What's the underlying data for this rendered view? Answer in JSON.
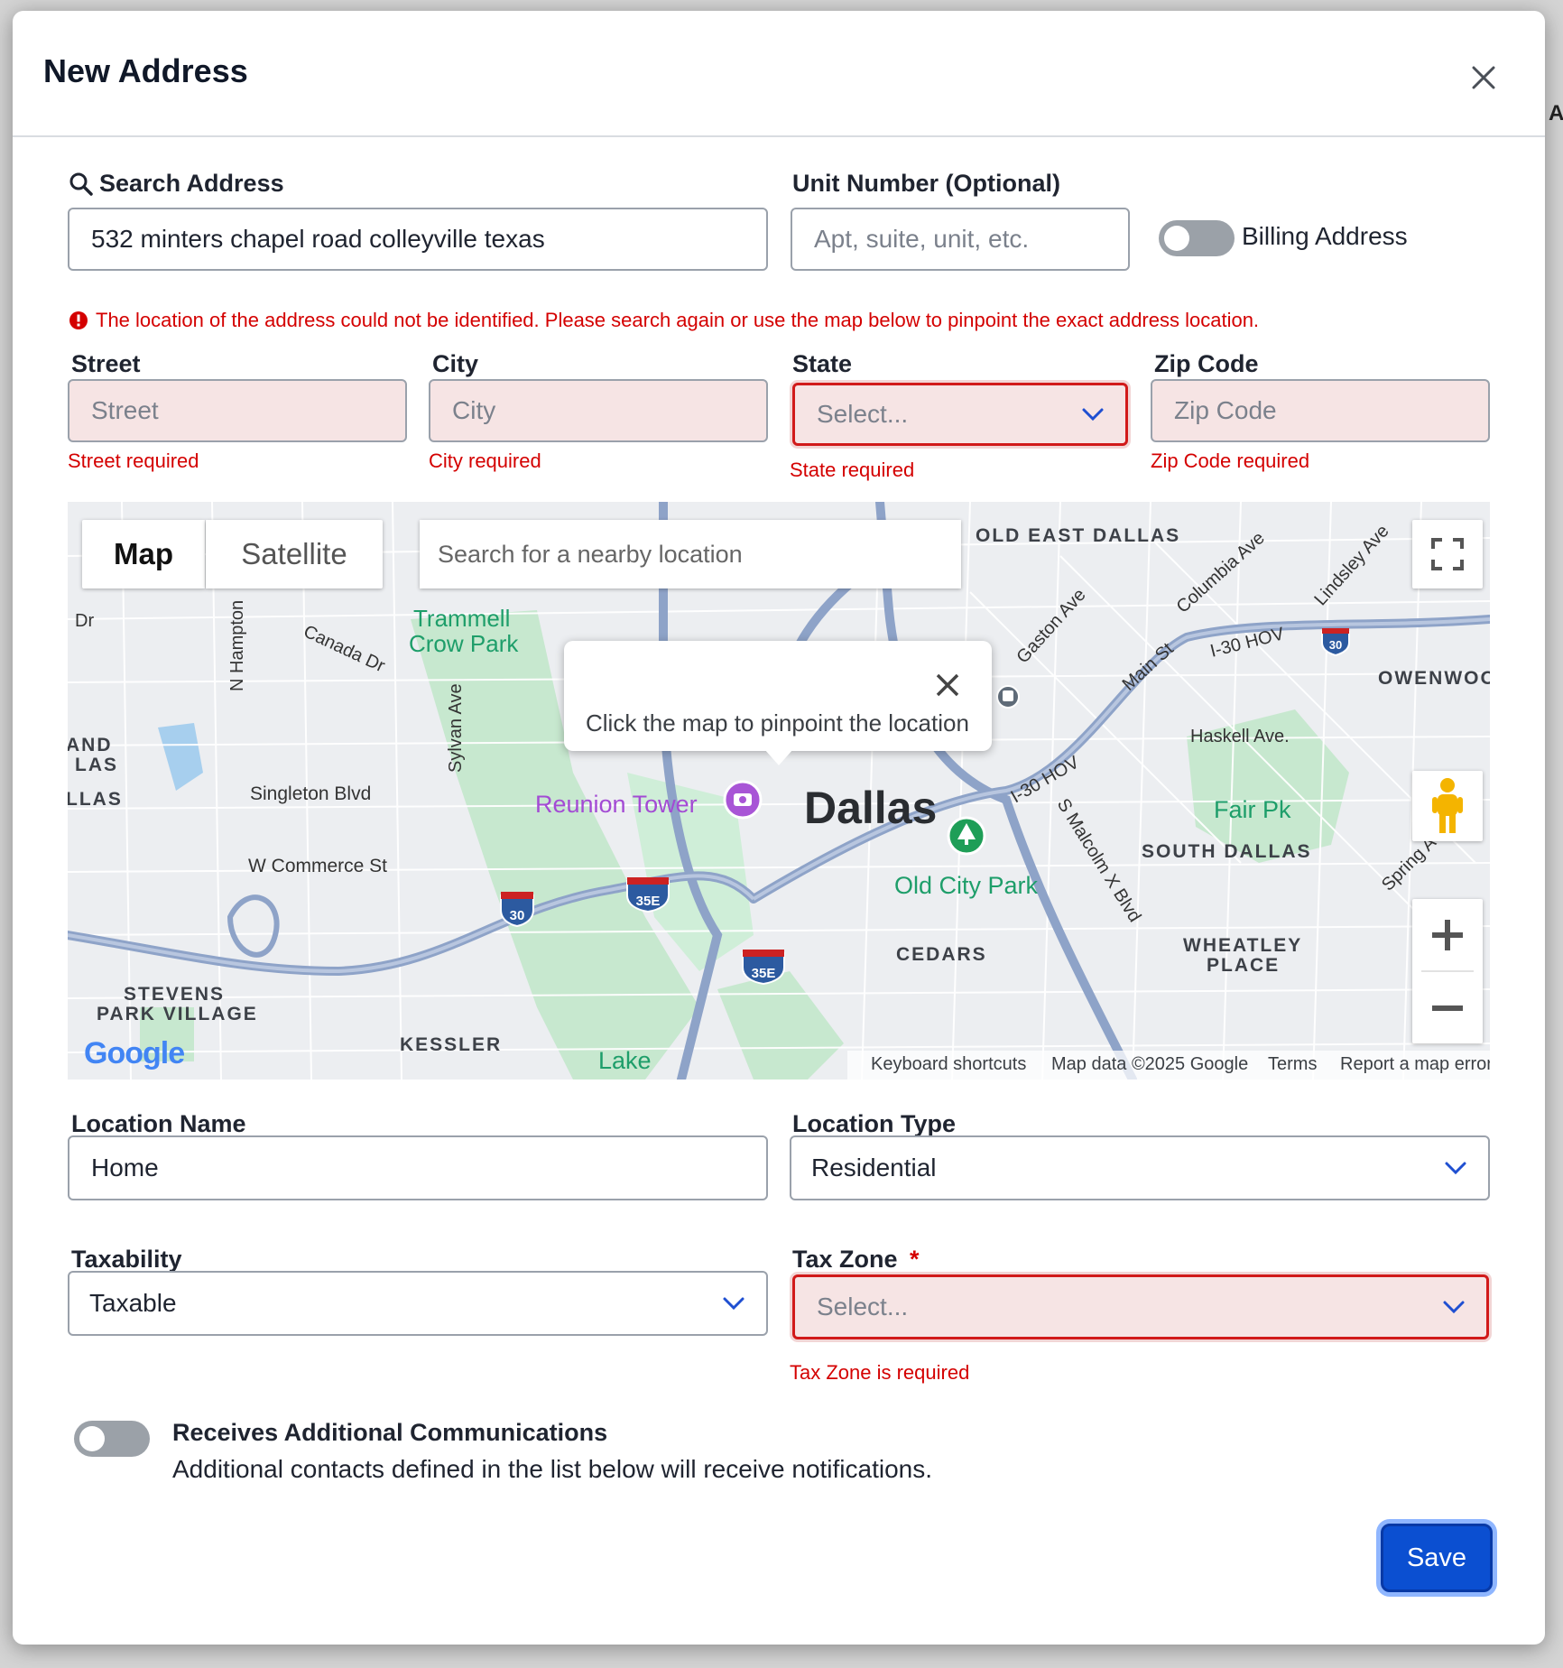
{
  "dialog": {
    "title": "New Address"
  },
  "search": {
    "label": "Search Address",
    "value": "532 minters chapel road colleyville texas"
  },
  "unit": {
    "label": "Unit Number (Optional)",
    "placeholder": "Apt, suite, unit, etc."
  },
  "billing": {
    "label": "Billing Address",
    "on": false
  },
  "alert": {
    "message": "The location of the address could not be identified. Please search again or use the map below to pinpoint the exact address location."
  },
  "street": {
    "label": "Street",
    "placeholder": "Street",
    "error": "Street required"
  },
  "city": {
    "label": "City",
    "placeholder": "City",
    "error": "City required"
  },
  "state": {
    "label": "State",
    "placeholder": "Select...",
    "error": "State required"
  },
  "zip": {
    "label": "Zip Code",
    "placeholder": "Zip Code",
    "error": "Zip Code required"
  },
  "map": {
    "tab_map": "Map",
    "tab_satellite": "Satellite",
    "search_placeholder": "Search for a nearby location",
    "popup_text": "Click the map to pinpoint the location",
    "city_label": "Dallas",
    "labels": {
      "old_east_dallas": "OLD EAST DALLAS",
      "trammell": "Trammell",
      "crow_park": "Crow Park",
      "canada_dr": "Canada Dr",
      "n_hampton": "N Hampton",
      "sylvan": "Sylvan Ave",
      "singleton": "Singleton Blvd",
      "w_commerce": "W Commerce St",
      "reunion": "Reunion Tower",
      "old_city_park": "Old City Park",
      "cedars": "CEDARS",
      "south_dallas": "SOUTH DALLAS",
      "fair_pk": "Fair Pk",
      "wheatley": "WHEATLEY",
      "place": "PLACE",
      "stevens": "STEVENS",
      "park_village": "PARK VILLAGE",
      "kessler": "KESSLER",
      "lake": "Lake",
      "haskell": "Haskell Ave.",
      "owenwood": "OWENWOO",
      "gaston": "Gaston Ave",
      "main_st": "Main St",
      "columbia": "Columbia Ave",
      "lindsley": "Lindsley Ave",
      "i30hov": "I-30 HOV",
      "i30hov2": "I-30 HOV",
      "malcolm": "S Malcolm X Blvd",
      "spring": "Spring Ave",
      "and_las": "AND",
      "las": "LAS",
      "llas": "LLAS",
      "dr": "Dr",
      "shield_30": "30",
      "shield_35e": "35E",
      "shield_35e_2": "35E",
      "shield_30_2": "30"
    },
    "logo": "Google",
    "attribution": {
      "shortcuts": "Keyboard shortcuts",
      "data": "Map data ©2025 Google",
      "terms": "Terms",
      "report": "Report a map error"
    }
  },
  "location_name": {
    "label": "Location Name",
    "value": "Home"
  },
  "location_type": {
    "label": "Location Type",
    "value": "Residential"
  },
  "taxability": {
    "label": "Taxability",
    "value": "Taxable"
  },
  "tax_zone": {
    "label": "Tax Zone",
    "required_mark": "*",
    "placeholder": "Select...",
    "error": "Tax Zone is required"
  },
  "communications": {
    "title": "Receives Additional Communications",
    "description": "Additional contacts defined in the list below will receive notifications.",
    "on": false
  },
  "actions": {
    "save_label": "Save"
  },
  "colors": {
    "primary": "#0b4fd1",
    "error": "#d40000",
    "error_bg": "#f6e4e4"
  }
}
